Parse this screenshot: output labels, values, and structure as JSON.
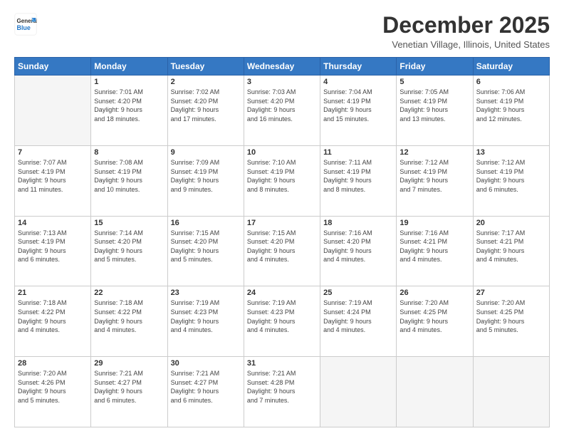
{
  "header": {
    "logo": {
      "general": "General",
      "blue": "Blue"
    },
    "title": "December 2025",
    "location": "Venetian Village, Illinois, United States"
  },
  "calendar": {
    "days_of_week": [
      "Sunday",
      "Monday",
      "Tuesday",
      "Wednesday",
      "Thursday",
      "Friday",
      "Saturday"
    ],
    "weeks": [
      [
        {
          "day": "",
          "info": ""
        },
        {
          "day": "1",
          "info": "Sunrise: 7:01 AM\nSunset: 4:20 PM\nDaylight: 9 hours\nand 18 minutes."
        },
        {
          "day": "2",
          "info": "Sunrise: 7:02 AM\nSunset: 4:20 PM\nDaylight: 9 hours\nand 17 minutes."
        },
        {
          "day": "3",
          "info": "Sunrise: 7:03 AM\nSunset: 4:20 PM\nDaylight: 9 hours\nand 16 minutes."
        },
        {
          "day": "4",
          "info": "Sunrise: 7:04 AM\nSunset: 4:19 PM\nDaylight: 9 hours\nand 15 minutes."
        },
        {
          "day": "5",
          "info": "Sunrise: 7:05 AM\nSunset: 4:19 PM\nDaylight: 9 hours\nand 13 minutes."
        },
        {
          "day": "6",
          "info": "Sunrise: 7:06 AM\nSunset: 4:19 PM\nDaylight: 9 hours\nand 12 minutes."
        }
      ],
      [
        {
          "day": "7",
          "info": "Sunrise: 7:07 AM\nSunset: 4:19 PM\nDaylight: 9 hours\nand 11 minutes."
        },
        {
          "day": "8",
          "info": "Sunrise: 7:08 AM\nSunset: 4:19 PM\nDaylight: 9 hours\nand 10 minutes."
        },
        {
          "day": "9",
          "info": "Sunrise: 7:09 AM\nSunset: 4:19 PM\nDaylight: 9 hours\nand 9 minutes."
        },
        {
          "day": "10",
          "info": "Sunrise: 7:10 AM\nSunset: 4:19 PM\nDaylight: 9 hours\nand 8 minutes."
        },
        {
          "day": "11",
          "info": "Sunrise: 7:11 AM\nSunset: 4:19 PM\nDaylight: 9 hours\nand 8 minutes."
        },
        {
          "day": "12",
          "info": "Sunrise: 7:12 AM\nSunset: 4:19 PM\nDaylight: 9 hours\nand 7 minutes."
        },
        {
          "day": "13",
          "info": "Sunrise: 7:12 AM\nSunset: 4:19 PM\nDaylight: 9 hours\nand 6 minutes."
        }
      ],
      [
        {
          "day": "14",
          "info": "Sunrise: 7:13 AM\nSunset: 4:19 PM\nDaylight: 9 hours\nand 6 minutes."
        },
        {
          "day": "15",
          "info": "Sunrise: 7:14 AM\nSunset: 4:20 PM\nDaylight: 9 hours\nand 5 minutes."
        },
        {
          "day": "16",
          "info": "Sunrise: 7:15 AM\nSunset: 4:20 PM\nDaylight: 9 hours\nand 5 minutes."
        },
        {
          "day": "17",
          "info": "Sunrise: 7:15 AM\nSunset: 4:20 PM\nDaylight: 9 hours\nand 4 minutes."
        },
        {
          "day": "18",
          "info": "Sunrise: 7:16 AM\nSunset: 4:20 PM\nDaylight: 9 hours\nand 4 minutes."
        },
        {
          "day": "19",
          "info": "Sunrise: 7:16 AM\nSunset: 4:21 PM\nDaylight: 9 hours\nand 4 minutes."
        },
        {
          "day": "20",
          "info": "Sunrise: 7:17 AM\nSunset: 4:21 PM\nDaylight: 9 hours\nand 4 minutes."
        }
      ],
      [
        {
          "day": "21",
          "info": "Sunrise: 7:18 AM\nSunset: 4:22 PM\nDaylight: 9 hours\nand 4 minutes."
        },
        {
          "day": "22",
          "info": "Sunrise: 7:18 AM\nSunset: 4:22 PM\nDaylight: 9 hours\nand 4 minutes."
        },
        {
          "day": "23",
          "info": "Sunrise: 7:19 AM\nSunset: 4:23 PM\nDaylight: 9 hours\nand 4 minutes."
        },
        {
          "day": "24",
          "info": "Sunrise: 7:19 AM\nSunset: 4:23 PM\nDaylight: 9 hours\nand 4 minutes."
        },
        {
          "day": "25",
          "info": "Sunrise: 7:19 AM\nSunset: 4:24 PM\nDaylight: 9 hours\nand 4 minutes."
        },
        {
          "day": "26",
          "info": "Sunrise: 7:20 AM\nSunset: 4:25 PM\nDaylight: 9 hours\nand 4 minutes."
        },
        {
          "day": "27",
          "info": "Sunrise: 7:20 AM\nSunset: 4:25 PM\nDaylight: 9 hours\nand 5 minutes."
        }
      ],
      [
        {
          "day": "28",
          "info": "Sunrise: 7:20 AM\nSunset: 4:26 PM\nDaylight: 9 hours\nand 5 minutes."
        },
        {
          "day": "29",
          "info": "Sunrise: 7:21 AM\nSunset: 4:27 PM\nDaylight: 9 hours\nand 6 minutes."
        },
        {
          "day": "30",
          "info": "Sunrise: 7:21 AM\nSunset: 4:27 PM\nDaylight: 9 hours\nand 6 minutes."
        },
        {
          "day": "31",
          "info": "Sunrise: 7:21 AM\nSunset: 4:28 PM\nDaylight: 9 hours\nand 7 minutes."
        },
        {
          "day": "",
          "info": ""
        },
        {
          "day": "",
          "info": ""
        },
        {
          "day": "",
          "info": ""
        }
      ]
    ]
  }
}
